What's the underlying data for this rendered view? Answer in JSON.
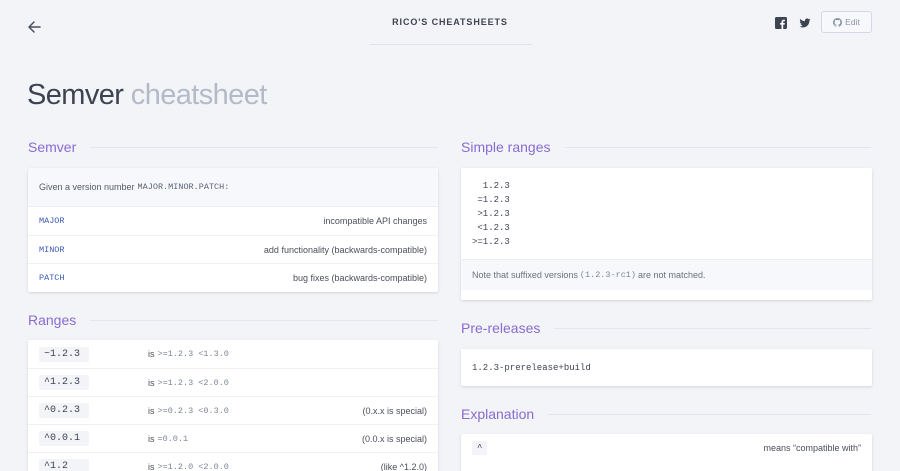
{
  "header": {
    "site_title": "RICO'S CHEATSHEETS",
    "edit_label": "Edit"
  },
  "page": {
    "title_main": "Semver",
    "title_light": "cheatsheet"
  },
  "semver": {
    "heading": "Semver",
    "intro_text": "Given a version number",
    "intro_code": "MAJOR.MINOR.PATCH:",
    "rows": [
      {
        "key": "MAJOR",
        "desc": "incompatible API changes"
      },
      {
        "key": "MINOR",
        "desc": "add functionality (backwards-compatible)"
      },
      {
        "key": "PATCH",
        "desc": "bug fixes (backwards-compatible)"
      }
    ]
  },
  "ranges": {
    "heading": "Ranges",
    "is_word": "is",
    "rows": [
      {
        "code": "~1.2.3",
        "range": ">=1.2.3 <1.3.0",
        "note": ""
      },
      {
        "code": "^1.2.3",
        "range": ">=1.2.3 <2.0.0",
        "note": ""
      },
      {
        "code": "^0.2.3",
        "range": ">=0.2.3 <0.3.0",
        "note": "(0.x.x is special)"
      },
      {
        "code": "^0.0.1",
        "range": "=0.0.1",
        "note": "(0.0.x is special)"
      },
      {
        "code": "^1.2",
        "range": ">=1.2.0 <2.0.0",
        "note": "(like ^1.2.0)"
      }
    ]
  },
  "simple_ranges": {
    "heading": "Simple ranges",
    "code_lines": [
      "  1.2.3",
      " =1.2.3",
      " >1.2.3",
      " <1.2.3",
      ">=1.2.3"
    ],
    "note_before": "Note that suffixed versions",
    "note_code": "(1.2.3-rc1)",
    "note_after": "are not matched."
  },
  "prereleases": {
    "heading": "Pre-releases",
    "code": "1.2.3-prerelease+build"
  },
  "explanation": {
    "heading": "Explanation",
    "rows": [
      {
        "code": "^",
        "desc": "means “compatible with”"
      }
    ]
  }
}
